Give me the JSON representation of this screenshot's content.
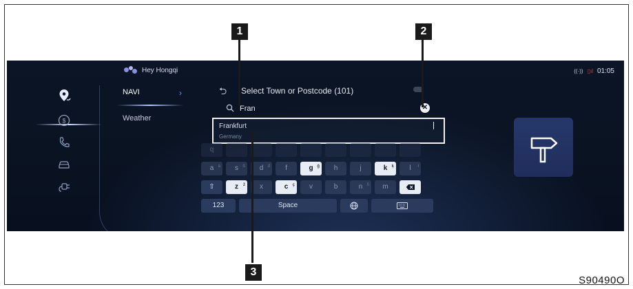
{
  "assistant": {
    "label": "Hey Hongqi"
  },
  "status": {
    "time": "01:05"
  },
  "sidebar": {
    "items": [
      {
        "icon": "navigation-pin-icon"
      },
      {
        "icon": "dollar-circle-icon"
      },
      {
        "icon": "phone-icon"
      },
      {
        "icon": "car-icon"
      },
      {
        "icon": "charging-plug-icon"
      }
    ]
  },
  "menu": {
    "navi": "NAVI",
    "weather": "Weather"
  },
  "header": {
    "title": "Select Town or Postcode (101)"
  },
  "search": {
    "value": "Fran"
  },
  "result": {
    "name": "Frankfurt",
    "country": "Germany"
  },
  "keyboard": {
    "row1": [
      "q",
      "",
      "",
      "",
      "",
      "",
      "",
      "",
      ""
    ],
    "row2": [
      "a",
      "s",
      "d",
      "f",
      "g",
      "h",
      "j",
      "k",
      "l"
    ],
    "row2_sup": [
      "à",
      "ß",
      "đ",
      "",
      "ğ",
      "",
      "",
      "ķ",
      "ł"
    ],
    "row3": [
      "z",
      "x",
      "c",
      "v",
      "b",
      "n",
      "m"
    ],
    "row3_sup": [
      "ž",
      "",
      "ç",
      "",
      "",
      "ñ",
      ""
    ],
    "numbers_label": "123",
    "space_label": "Space"
  },
  "callouts": {
    "one": "1",
    "two": "2",
    "three": "3"
  },
  "figure_code": "S90490O",
  "colors": {
    "screen_bg": "#0b1526",
    "accent": "#6f8fff",
    "card": "#26376a"
  }
}
